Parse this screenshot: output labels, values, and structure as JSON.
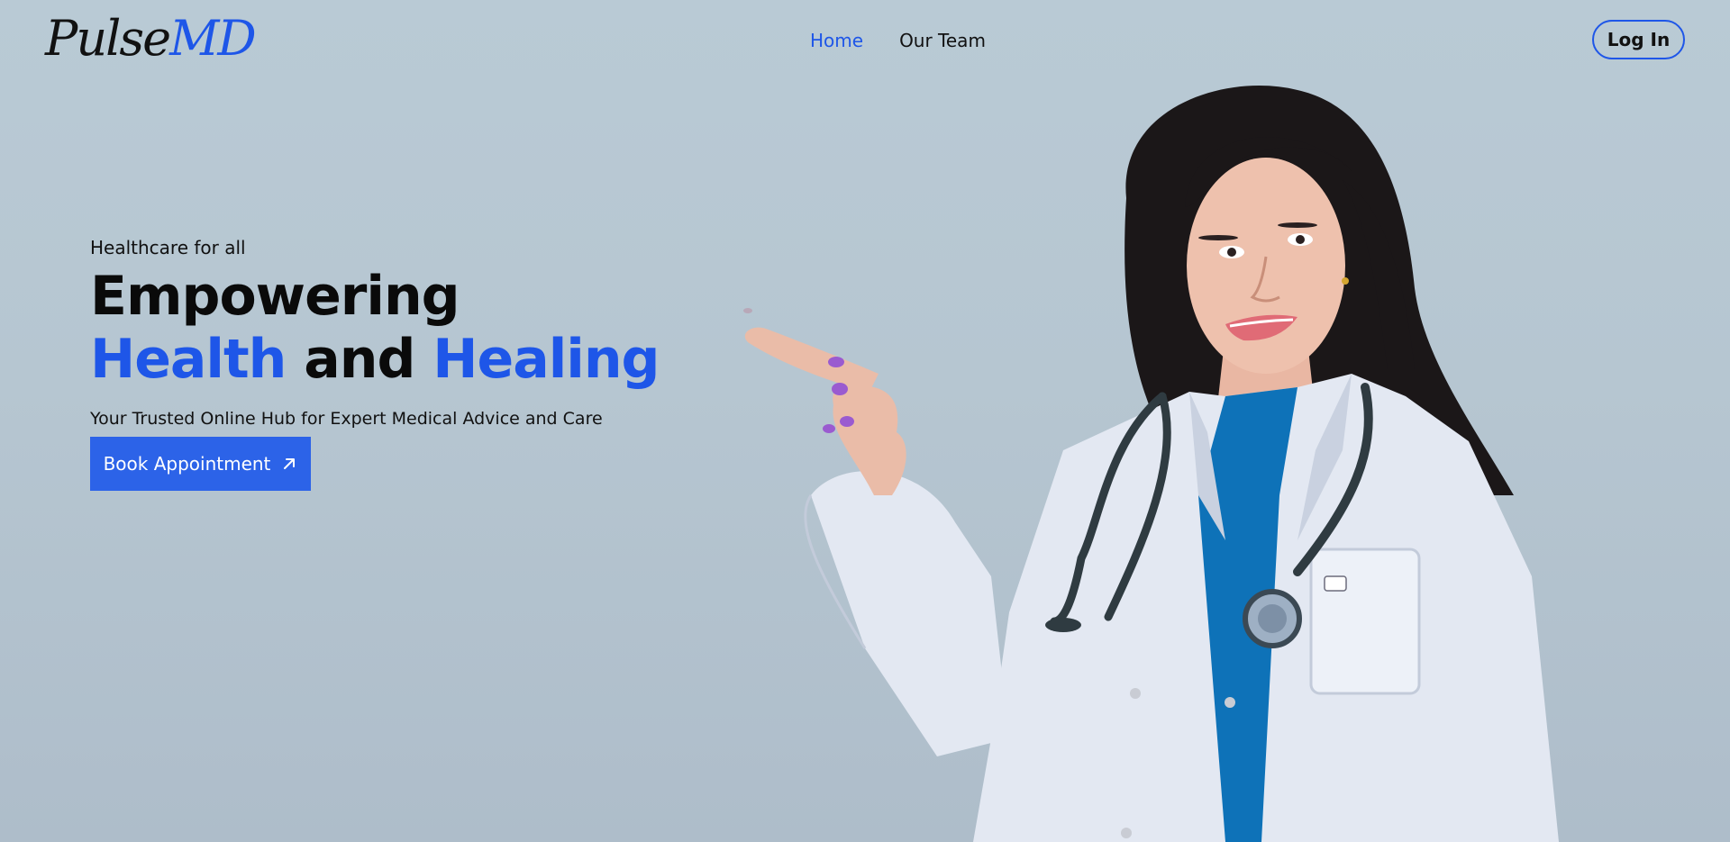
{
  "brand": {
    "logo_part1": "Pulse",
    "logo_part2": "MD"
  },
  "nav": {
    "items": [
      {
        "label": "Home",
        "active": true
      },
      {
        "label": "Our Team",
        "active": false
      }
    ]
  },
  "header": {
    "login_label": "Log In"
  },
  "hero": {
    "tagline": "Healthcare for all",
    "headline_line1": "Empowering",
    "headline_word_blue1": "Health",
    "headline_word_middle": "and",
    "headline_word_blue2": "Healing",
    "subtitle": "Your Trusted Online Hub for Expert Medical Advice and Care",
    "cta_label": "Book Appointment",
    "cta_icon": "arrow-up-right-icon"
  },
  "colors": {
    "accent": "#1e56e8",
    "button_bg": "#2c63e8",
    "background": "#b9cad5",
    "text": "#111111"
  },
  "illustration": {
    "subject": "doctor-photo",
    "icon": "doctor-illustration"
  }
}
